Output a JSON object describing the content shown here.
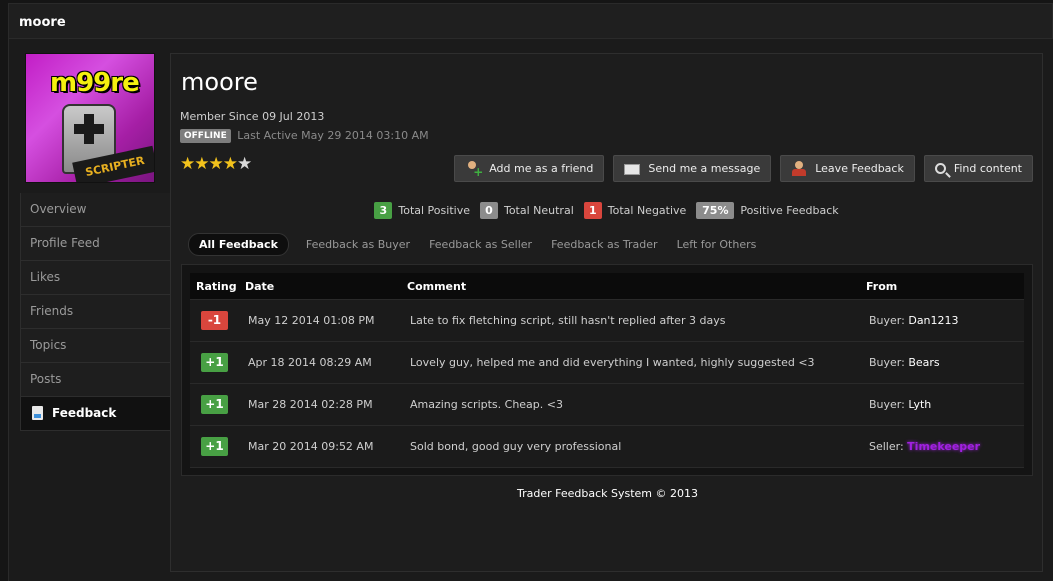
{
  "page": {
    "title": "moore"
  },
  "profile": {
    "avatar": {
      "logo_text": "m99re",
      "tag_text": "SCRIPTER"
    },
    "username": "moore",
    "member_since": "Member Since 09 Jul 2013",
    "status_badge": "OFFLINE",
    "last_active": "Last Active May 29 2014 03:10 AM",
    "rating": {
      "stars_filled": 4,
      "stars_total": 5
    }
  },
  "sidenav": {
    "items": [
      {
        "label": "Overview"
      },
      {
        "label": "Profile Feed"
      },
      {
        "label": "Likes"
      },
      {
        "label": "Friends"
      },
      {
        "label": "Topics"
      },
      {
        "label": "Posts"
      },
      {
        "label": "Feedback",
        "active": true
      }
    ]
  },
  "actions": {
    "add_friend": "Add me as a friend",
    "send_message": "Send me a message",
    "leave_feedback": "Leave Feedback",
    "find_content": "Find content"
  },
  "totals": {
    "positive_count": "3",
    "positive_label": "Total Positive",
    "neutral_count": "0",
    "neutral_label": "Total Neutral",
    "negative_count": "1",
    "negative_label": "Total Negative",
    "percent": "75%",
    "percent_label": "Positive Feedback"
  },
  "tabs": [
    {
      "label": "All Feedback",
      "active": true
    },
    {
      "label": "Feedback as Buyer"
    },
    {
      "label": "Feedback as Seller"
    },
    {
      "label": "Feedback as Trader"
    },
    {
      "label": "Left for Others"
    }
  ],
  "table": {
    "headers": {
      "rating": "Rating",
      "date": "Date",
      "comment": "Comment",
      "from": "From"
    },
    "rows": [
      {
        "rating": "-1",
        "type": "neg",
        "date": "May 12 2014 01:08 PM",
        "comment": "Late to fix fletching script, still hasn't replied after 3 days",
        "role": "Buyer:",
        "name": "Dan1213"
      },
      {
        "rating": "+1",
        "type": "pos",
        "date": "Apr 18 2014 08:29 AM",
        "comment": "Lovely guy, helped me and did everything I wanted, highly suggested <3",
        "role": "Buyer:",
        "name": "Bears"
      },
      {
        "rating": "+1",
        "type": "pos",
        "date": "Mar 28 2014 02:28 PM",
        "comment": "Amazing scripts. Cheap. <3",
        "role": "Buyer:",
        "name": "Lyth"
      },
      {
        "rating": "+1",
        "type": "pos",
        "date": "Mar 20 2014 09:52 AM",
        "comment": "Sold bond, good guy very professional",
        "role": "Seller:",
        "name": "Timekeeper",
        "special": true
      }
    ]
  },
  "footer": {
    "note": "Trader Feedback System © 2013"
  },
  "colors": {
    "positive": "#48a044",
    "negative": "#d9463d",
    "neutral": "#8c8c8c",
    "star": "#f2c21c",
    "special_name": "#a020e0"
  }
}
